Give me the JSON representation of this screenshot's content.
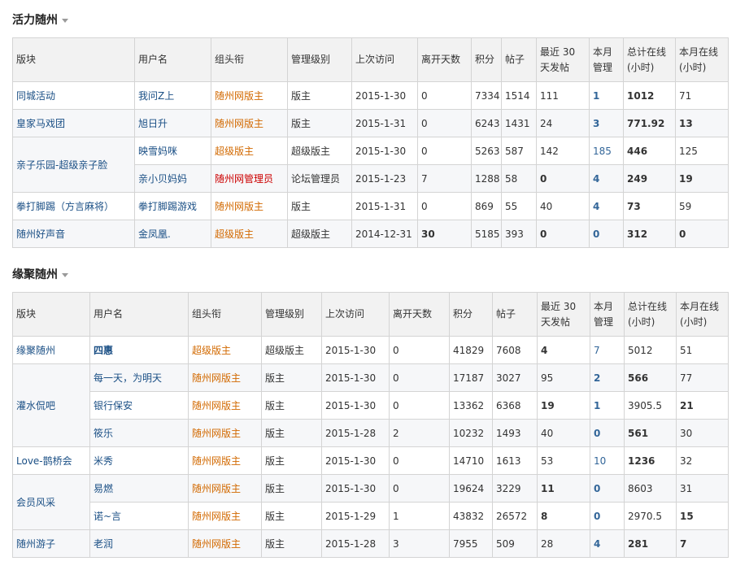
{
  "headers": [
    "版块",
    "用户名",
    "组头衔",
    "管理级别",
    "上次访问",
    "离开天数",
    "积分",
    "帖子",
    "最近 30 天发帖",
    "本月管理",
    "总计在线(小时)",
    "本月在线(小时)"
  ],
  "section1": {
    "title": "活力随州",
    "rows": [
      {
        "board": "同城活动",
        "user": "我问Z上",
        "title": "随州网版主",
        "level": "版主",
        "last_visit": "2015-1-30",
        "days_away": "0",
        "points": "7334",
        "posts": "1514",
        "recent30": "111",
        "month_manage": "1",
        "total_online": "1012",
        "month_online": "71"
      },
      {
        "board": "皇家马戏团",
        "user": "旭日升",
        "title": "随州网版主",
        "level": "版主",
        "last_visit": "2015-1-31",
        "days_away": "0",
        "points": "6243",
        "posts": "1431",
        "recent30": "24",
        "month_manage": "3",
        "total_online": "771.92",
        "month_online": "13"
      },
      {
        "board": "亲子乐园-超级亲子脸",
        "user": "映雪妈咪",
        "title": "超级版主",
        "level": "超级版主",
        "last_visit": "2015-1-30",
        "days_away": "0",
        "points": "5263",
        "posts": "587",
        "recent30": "142",
        "month_manage": "185",
        "total_online": "446",
        "month_online": "125"
      },
      {
        "board": "",
        "user": "亲小贝妈妈",
        "title": "随州网管理员",
        "level": "论坛管理员",
        "last_visit": "2015-1-23",
        "days_away": "7",
        "points": "1288",
        "posts": "58",
        "recent30": "0",
        "month_manage": "4",
        "total_online": "249",
        "month_online": "19"
      },
      {
        "board": "拳打脚踢（方言麻将）",
        "user": "拳打脚踢游戏",
        "title": "随州网版主",
        "level": "版主",
        "last_visit": "2015-1-31",
        "days_away": "0",
        "points": "869",
        "posts": "55",
        "recent30": "40",
        "month_manage": "4",
        "total_online": "73",
        "month_online": "59"
      },
      {
        "board": "随州好声音",
        "user": "金凤凰.",
        "title": "超级版主",
        "level": "超级版主",
        "last_visit": "2014-12-31",
        "days_away": "30",
        "points": "5185",
        "posts": "393",
        "recent30": "0",
        "month_manage": "0",
        "total_online": "312",
        "month_online": "0"
      }
    ]
  },
  "section2": {
    "title": "缘聚随州",
    "rows": [
      {
        "board": "缘聚随州",
        "user": "四惠",
        "title": "超级版主",
        "level": "超级版主",
        "last_visit": "2015-1-30",
        "days_away": "0",
        "points": "41829",
        "posts": "7608",
        "recent30": "4",
        "month_manage": "7",
        "total_online": "5012",
        "month_online": "51"
      },
      {
        "board": "灌水侃吧",
        "user": "每一天，为明天",
        "title": "随州网版主",
        "level": "版主",
        "last_visit": "2015-1-30",
        "days_away": "0",
        "points": "17187",
        "posts": "3027",
        "recent30": "95",
        "month_manage": "2",
        "total_online": "566",
        "month_online": "77"
      },
      {
        "board": "",
        "user": "银行保安",
        "title": "随州网版主",
        "level": "版主",
        "last_visit": "2015-1-30",
        "days_away": "0",
        "points": "13362",
        "posts": "6368",
        "recent30": "19",
        "month_manage": "1",
        "total_online": "3905.5",
        "month_online": "21"
      },
      {
        "board": "",
        "user": "筱乐",
        "title": "随州网版主",
        "level": "版主",
        "last_visit": "2015-1-28",
        "days_away": "2",
        "points": "10232",
        "posts": "1493",
        "recent30": "40",
        "month_manage": "0",
        "total_online": "561",
        "month_online": "30"
      },
      {
        "board": "Love-鹊桥会",
        "user": "米秀",
        "title": "随州网版主",
        "level": "版主",
        "last_visit": "2015-1-30",
        "days_away": "0",
        "points": "14710",
        "posts": "1613",
        "recent30": "53",
        "month_manage": "10",
        "total_online": "1236",
        "month_online": "32"
      },
      {
        "board": "会员风采",
        "user": "易燃",
        "title": "随州网版主",
        "level": "版主",
        "last_visit": "2015-1-30",
        "days_away": "0",
        "points": "19624",
        "posts": "3229",
        "recent30": "11",
        "month_manage": "0",
        "total_online": "8603",
        "month_online": "31"
      },
      {
        "board": "",
        "user": "诺~言",
        "title": "随州网版主",
        "level": "版主",
        "last_visit": "2015-1-29",
        "days_away": "1",
        "points": "43832",
        "posts": "26572",
        "recent30": "8",
        "month_manage": "0",
        "total_online": "2970.5",
        "month_online": "15"
      },
      {
        "board": "随州游子",
        "user": "老润",
        "title": "随州网版主",
        "level": "版主",
        "last_visit": "2015-1-28",
        "days_away": "3",
        "points": "7955",
        "posts": "509",
        "recent30": "28",
        "month_manage": "4",
        "total_online": "281",
        "month_online": "7"
      }
    ]
  }
}
